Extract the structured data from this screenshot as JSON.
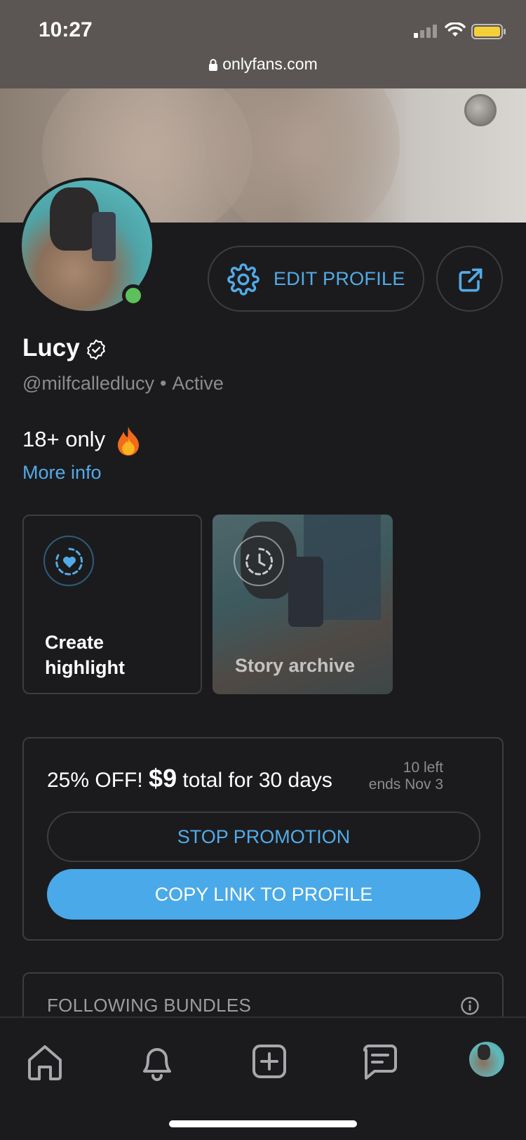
{
  "status_bar": {
    "time": "10:27",
    "url": "onlyfans.com"
  },
  "profile": {
    "name": "Lucy",
    "handle": "@milfcalledlucy",
    "separator": "•",
    "status": "Active",
    "online_color": "#5dc15b"
  },
  "actions": {
    "edit_profile": "EDIT PROFILE",
    "share_icon": "share-icon",
    "settings_icon": "gear-icon"
  },
  "bio": {
    "text": "18+ only",
    "emoji_icon": "fire-emoji-icon",
    "more_info": "More info"
  },
  "highlights": {
    "create": "Create highlight",
    "create_line1": "Create",
    "create_line2": "highlight",
    "archive": "Story archive"
  },
  "promotion": {
    "prefix": "25% OFF! ",
    "price": "$9",
    "suffix": " total for 30 days",
    "remaining": "10 left",
    "ends": "ends Nov 3",
    "stop_button": "STOP PROMOTION",
    "copy_button": "COPY LINK TO PROFILE"
  },
  "bundles": {
    "title": "FOLLOWING BUNDLES"
  },
  "bottom_nav": {
    "items": [
      "home-icon",
      "bell-icon",
      "add-post-icon",
      "messages-icon",
      "profile-avatar"
    ]
  },
  "colors": {
    "accent": "#52abe8",
    "background": "#1b1b1d",
    "button_primary": "#4aa9e8",
    "border": "#3b3d41"
  }
}
